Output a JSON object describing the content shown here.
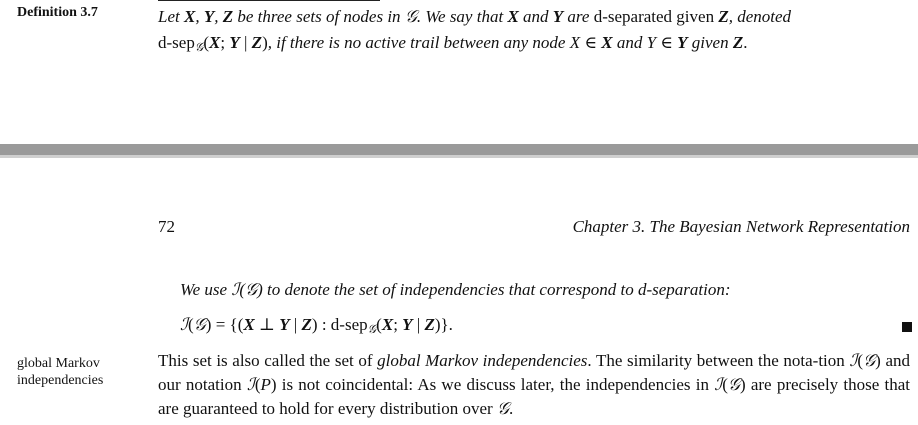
{
  "definition": {
    "label": "Definition 3.7",
    "line1": {
      "lead": "Let ",
      "X": "X",
      "sep1": ", ",
      "Y": "Y",
      "sep2": ", ",
      "Z": "Z",
      "text1": " be three sets of nodes in ",
      "G": "𝒢",
      "text2": ". We say that ",
      "X2": "X",
      "and1": " and ",
      "Y2": "Y",
      "are": " are ",
      "dsep_text": "d-separated given ",
      "Z2": "Z",
      "denoted": ", denoted"
    },
    "line2": {
      "dsep": "d-sep",
      "sub_G": "𝒢",
      "open": "(",
      "X": "X",
      "semi": "; ",
      "Y": "Y",
      "bar": " | ",
      "Z": "Z",
      "close": ")",
      "text1": ", if there is no active trail between any node ",
      "x": "X",
      "in1": " ∈ ",
      "Xs": "X",
      "and": " and ",
      "y": "Y",
      "in2": " ∈ ",
      "Ys": "Y",
      "given": " given ",
      "Zs": "Z",
      "end": "."
    }
  },
  "page_header": {
    "page_number": "72",
    "running_head": "Chapter 3.  The Bayesian Network Representation"
  },
  "body": {
    "intro": {
      "pre": "We use ",
      "I": "ℐ",
      "open": "(",
      "G": "𝒢",
      "close": ")",
      "post": " to denote the set of independencies that correspond to d-separation:"
    },
    "equation": {
      "I": "ℐ",
      "open": "(",
      "G": "𝒢",
      "close": ")",
      "eq": " = {(",
      "X": "X",
      "perp": " ⊥ ",
      "Y": "Y",
      "bar": " | ",
      "Z": "Z",
      "rest": ")  :  d-sep",
      "sub_G": "𝒢",
      "open2": "(",
      "X2": "X",
      "semi": "; ",
      "Y2": "Y",
      "bar2": " | ",
      "Z2": "Z",
      "end": ")}."
    },
    "margin_note": [
      "global Markov",
      "independencies"
    ],
    "paragraph": {
      "t1": "This set is also called the set of ",
      "em": "global Markov independencies",
      "t2": ". The similarity between the nota-tion ",
      "I1": "ℐ",
      "o1": "(",
      "G1": "𝒢",
      "c1": ")",
      "t3": " and our notation ",
      "I2": "ℐ",
      "o2": "(",
      "P": "P",
      "c2": ")",
      "t4": " is not coincidental: As we discuss later, the independencies in ",
      "I3": "ℐ",
      "o3": "(",
      "G3": "𝒢",
      "c3": ")",
      "t5": " are precisely those that are guaranteed to hold for every distribution over ",
      "G4": "𝒢",
      "t6": "."
    }
  }
}
